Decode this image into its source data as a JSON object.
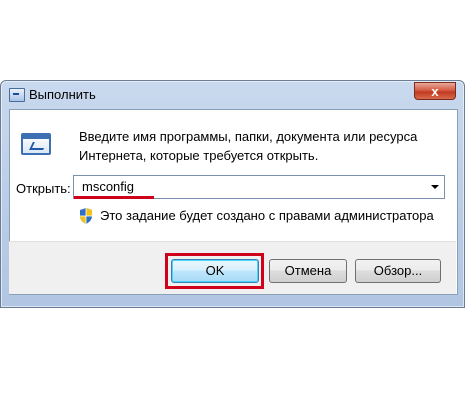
{
  "window": {
    "title": "Выполнить",
    "close_glyph": "x"
  },
  "dialog": {
    "description": "Введите имя программы, папки, документа или ресурса Интернета, которые требуется открыть.",
    "open_label": "Открыть:",
    "open_value": "msconfig",
    "uac_note": "Это задание будет создано с правами администратора"
  },
  "buttons": {
    "ok": "OK",
    "cancel": "Отмена",
    "browse": "Обзор..."
  },
  "icons": {
    "window": "run-window-icon",
    "run": "run-program-icon",
    "shield": "uac-shield-icon",
    "dropdown": "chevron-down-icon"
  },
  "colors": {
    "annotation_red": "#d0021b",
    "ok_accent": "#3c7fb1"
  }
}
